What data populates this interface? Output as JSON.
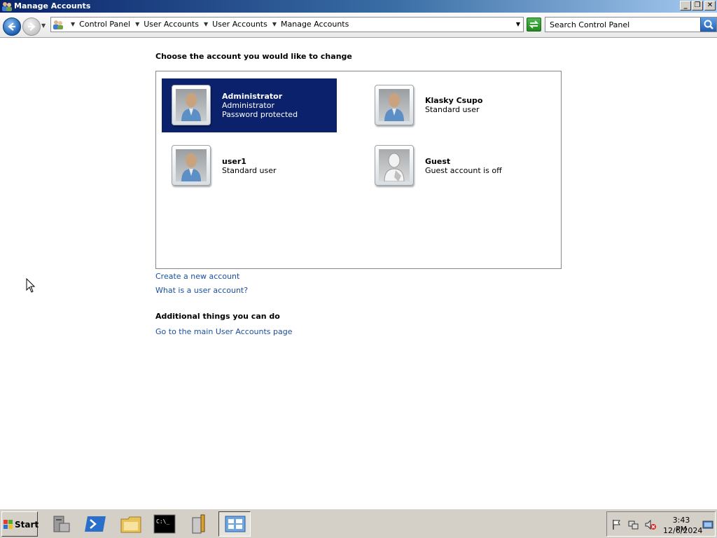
{
  "window": {
    "title": "Manage Accounts"
  },
  "address": {
    "breadcrumbs": [
      "Control Panel",
      "User Accounts",
      "User Accounts",
      "Manage Accounts"
    ],
    "search_placeholder": "Search Control Panel"
  },
  "main": {
    "heading": "Choose the account you would like to change",
    "accounts": [
      {
        "name": "Administrator",
        "line1": "Administrator",
        "line2": "Password protected",
        "selected": true
      },
      {
        "name": "Klasky Csupo",
        "line1": "Standard user",
        "line2": ""
      },
      {
        "name": "user1",
        "line1": "Standard user",
        "line2": ""
      },
      {
        "name": "Guest",
        "line1": "Guest account is off",
        "line2": ""
      }
    ],
    "links": {
      "create": "Create a new account",
      "what": "What is a user account?"
    },
    "additional_heading": "Additional things you can do",
    "additional_link": "Go to the main User Accounts page"
  },
  "taskbar": {
    "start_label": "Start",
    "clock_time": "3:43 PM",
    "clock_date": "12/6/2024"
  },
  "colors": {
    "selection": "#0b216b",
    "link": "#1a4fa0",
    "taskbar": "#d4d0c8"
  }
}
